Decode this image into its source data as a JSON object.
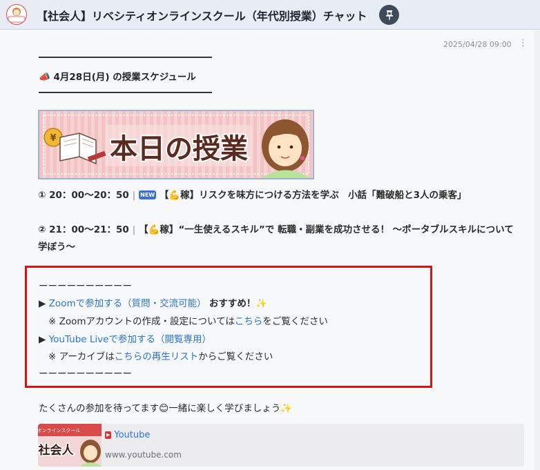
{
  "header": {
    "title": "【社会人】リベシティオンラインスクール（年代別授業）チャット",
    "avatar_text": "社会人",
    "pin_icon": "pin-icon"
  },
  "message": {
    "timestamp": "2025/04/28 09:00",
    "menu_glyph": "⋮",
    "schedule_emoji": "📣",
    "schedule_title": "4月28日(月) の授業スケジュール",
    "banner": {
      "text": "本日の授業",
      "icon": "open-book-with-yen-coin-and-teacher-illustration"
    },
    "classes": [
      {
        "prefix": "① 20：00〜20：50",
        "badge": "NEW",
        "text": "【💪稼】リスクを味方につける方法を学ぶ　小話「難破船と3人の乗客」"
      },
      {
        "prefix": "② 21：00〜21：50",
        "text": "【💪稼】“一生使えるスキル”で 転職・副業を成功させる！ 〜ポータブルスキルについて学ぼう〜"
      }
    ],
    "links_box": {
      "divider": "ーーーーーーーーーー",
      "zoom_arrow": "▶",
      "zoom_link": "Zoomで参加する（質問・交流可能）",
      "zoom_recommend": "おすすめ！",
      "sparkle": "✨",
      "zoom_note_prefix": "※ Zoomアカウントの作成・設定については",
      "zoom_note_link": "こちら",
      "zoom_note_suffix": "をご覧ください",
      "youtube_arrow": "▶",
      "youtube_link": "YouTube Liveで参加する（閲覧専用）",
      "archive_prefix": "※ アーカイブは",
      "archive_link": "こちらの再生リスト",
      "archive_suffix": "からご覧ください"
    },
    "invite_prefix": "たくさんの参加を待ってます",
    "invite_smile": "😊",
    "invite_suffix": "一緒に楽しく学びましょう",
    "invite_sparkle": "✨",
    "link_card": {
      "thumb_label_top": "オンラインスクール",
      "thumb_label": "社会人",
      "title": "Youtube",
      "url": "www.youtube.com"
    }
  },
  "colors": {
    "link": "#2a74d8",
    "highlight_box": "#e01010",
    "header_bg": "#e8ecf5"
  }
}
